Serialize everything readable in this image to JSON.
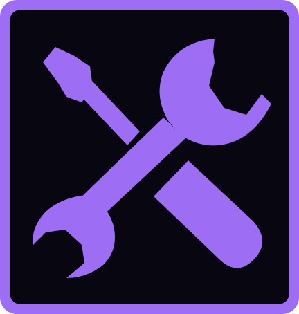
{
  "icon": {
    "name": "tools-icon",
    "glyphs": [
      "screwdriver",
      "wrench"
    ]
  },
  "colors": {
    "frame": "#9d6ef3",
    "background": "#080611",
    "glyph": "#9d6ef3"
  }
}
